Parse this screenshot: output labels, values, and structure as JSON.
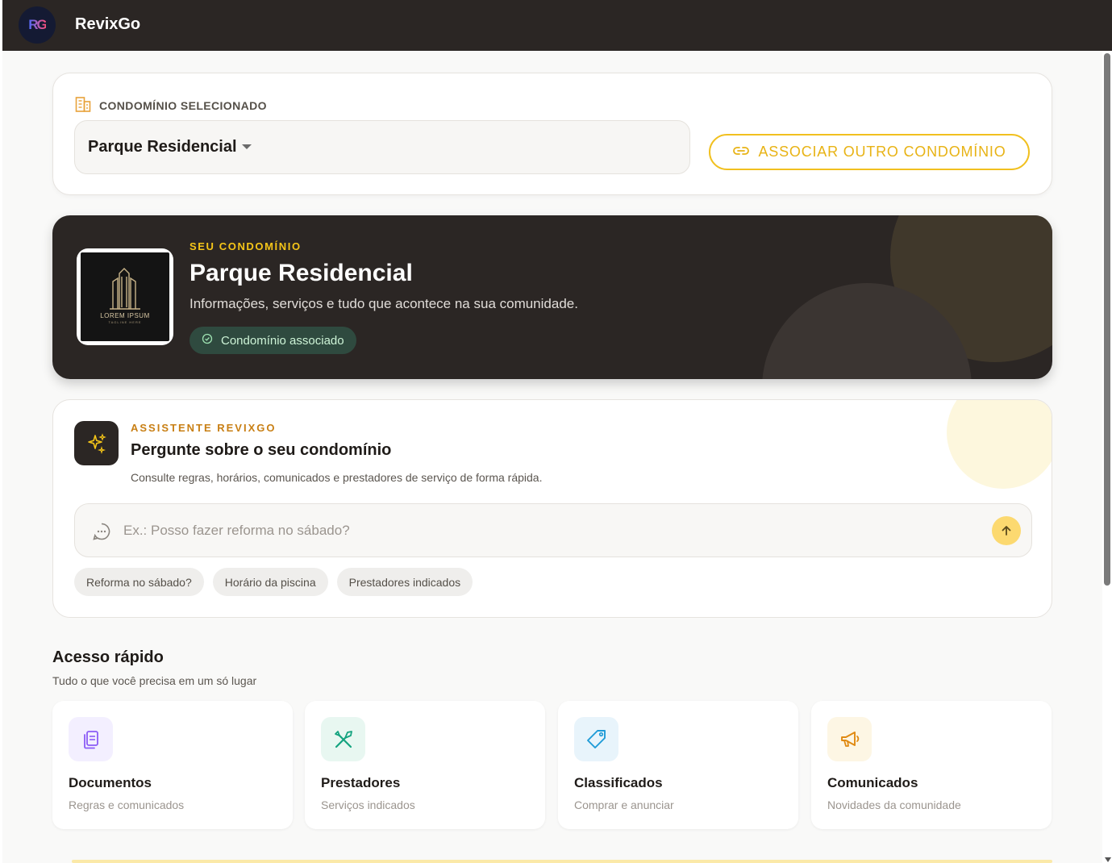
{
  "app": {
    "logo_text": "RG",
    "title": "RevixGo"
  },
  "condo_select": {
    "label": "CONDOMÍNIO SELECIONADO",
    "selected": "Parque Residencial",
    "associate_button": "ASSOCIAR OUTRO CONDOMÍNIO",
    "accent_color": "#f1c01f"
  },
  "hero": {
    "eyebrow": "SEU CONDOMÍNIO",
    "title": "Parque Residencial",
    "description": "Informações, serviços e tudo que acontece na sua comunidade.",
    "badge": "Condomínio associado",
    "logo_text": "LOREM IPSUM",
    "logo_tagline": "TAGLINE HERE"
  },
  "assistant": {
    "eyebrow": "ASSISTENTE REVIXGO",
    "title": "Pergunte sobre o seu condomínio",
    "description": "Consulte regras, horários, comunicados e prestadores de serviço de forma rápida.",
    "input_placeholder": "Ex.: Posso fazer reforma no sábado?",
    "chips": [
      "Reforma no sábado?",
      "Horário da piscina",
      "Prestadores indicados"
    ]
  },
  "quick_access": {
    "title": "Acesso rápido",
    "subtitle": "Tudo o que você precisa em um só lugar",
    "items": [
      {
        "title": "Documentos",
        "subtitle": "Regras e comunicados",
        "icon": "documents-icon",
        "color": "#8b5cf6"
      },
      {
        "title": "Prestadores",
        "subtitle": "Serviços indicados",
        "icon": "tools-icon",
        "color": "#14a37f"
      },
      {
        "title": "Classificados",
        "subtitle": "Comprar e anunciar",
        "icon": "tag-icon",
        "color": "#1e9bd7"
      },
      {
        "title": "Comunicados",
        "subtitle": "Novidades da comunidade",
        "icon": "megaphone-icon",
        "color": "#e08a12"
      }
    ]
  }
}
